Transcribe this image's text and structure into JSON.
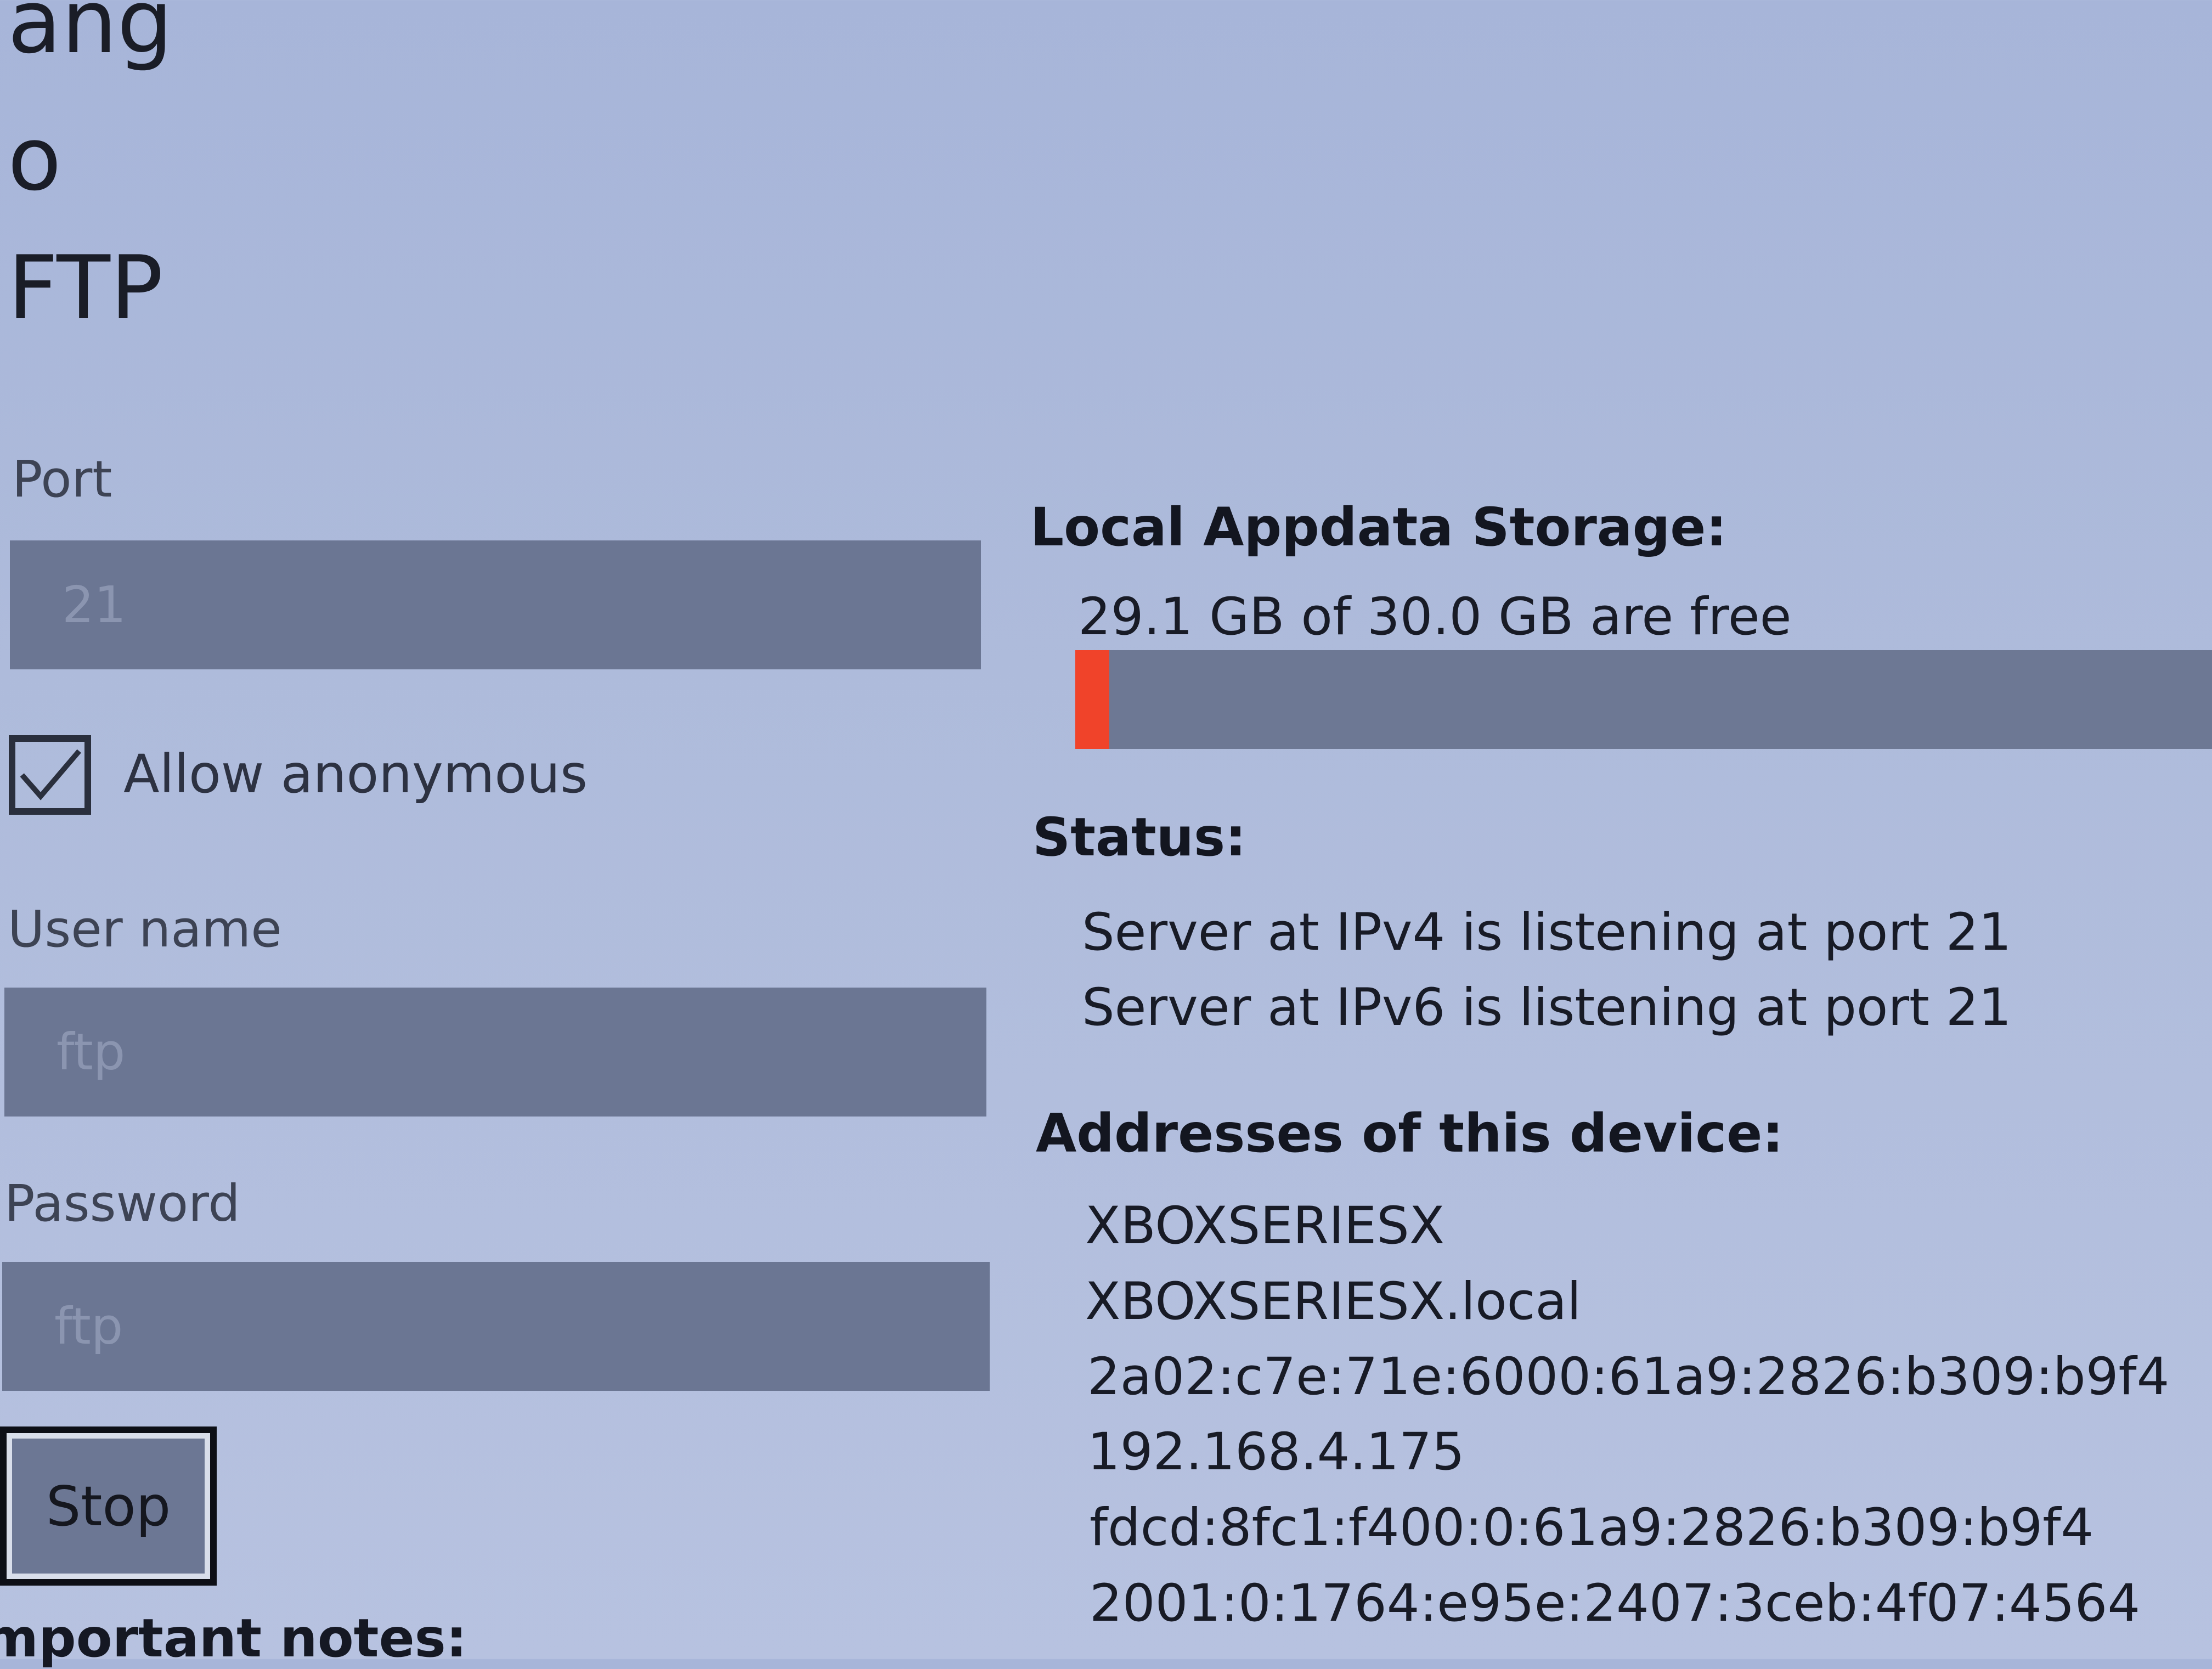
{
  "header": {
    "title_lines": [
      "ang",
      "o",
      "FTP"
    ]
  },
  "settings": {
    "port_label": "Port",
    "port_placeholder": "21",
    "allow_anonymous_label": "Allow anonymous",
    "allow_anonymous_checked": true,
    "username_label": "User name",
    "username_placeholder": "ftp",
    "password_label": "Password",
    "password_placeholder": "ftp",
    "stop_label": "Stop",
    "notes_heading": "mportant notes:"
  },
  "storage": {
    "heading": "Local Appdata Storage:",
    "text": "29.1 GB of 30.0 GB are free",
    "free_gb": 29.1,
    "total_gb": 30.0,
    "used_fraction": 0.03,
    "bar_fill_color": "#f0432a",
    "bar_track_color": "#6d7894"
  },
  "status": {
    "heading": "Status:",
    "lines": [
      "Server at IPv4 is listening at port 21",
      "Server at IPv6 is listening at port 21"
    ]
  },
  "addresses": {
    "heading": "Addresses of this device:",
    "items": [
      "XBOXSERIESX",
      "XBOXSERIESX.local",
      "2a02:c7e:71e:6000:61a9:2826:b309:b9f4",
      "192.168.4.175",
      "fdcd:8fc1:f400:0:61a9:2826:b309:b9f4",
      "2001:0:1764:e95e:2407:3ceb:4f07:4564"
    ]
  },
  "icons": {
    "checkbox": "checkmark-icon"
  }
}
